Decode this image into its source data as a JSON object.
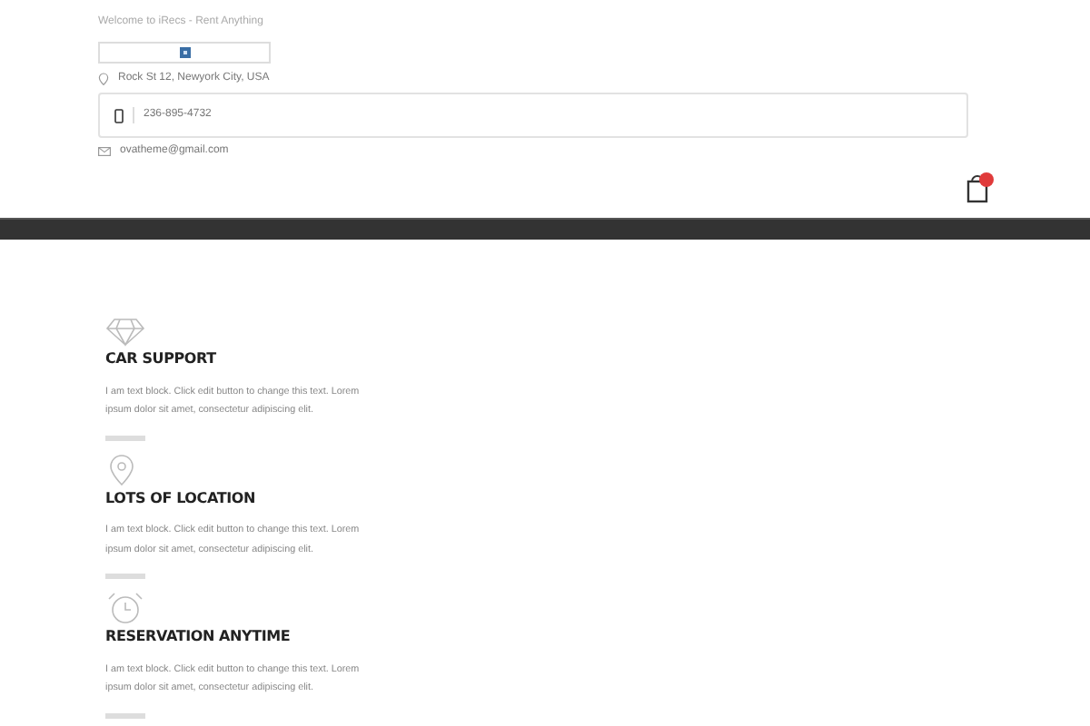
{
  "topbar": {
    "welcome": "Welcome to iRecs - Rent Anything"
  },
  "contact": {
    "address": "Rock St 12, Newyork City, USA",
    "phone": "236-895-4732",
    "email": "ovatheme@gmail.com"
  },
  "features": [
    {
      "kind": "diamond",
      "title": "CAR SUPPORT",
      "text": "I am text block. Click edit button to change this text. Lorem ipsum dolor sit amet, consectetur adipiscing elit."
    },
    {
      "kind": "pin",
      "title": "LOTS OF LOCATION",
      "text": "I am text block. Click edit button to change this text. Lorem ipsum dolor sit amet, consectetur adipiscing elit."
    },
    {
      "kind": "clock",
      "title": "RESERVATION ANYTIME",
      "text": "I am text block. Click edit button to change this text. Lorem ipsum dolor sit amet, consectetur adipiscing elit."
    }
  ]
}
